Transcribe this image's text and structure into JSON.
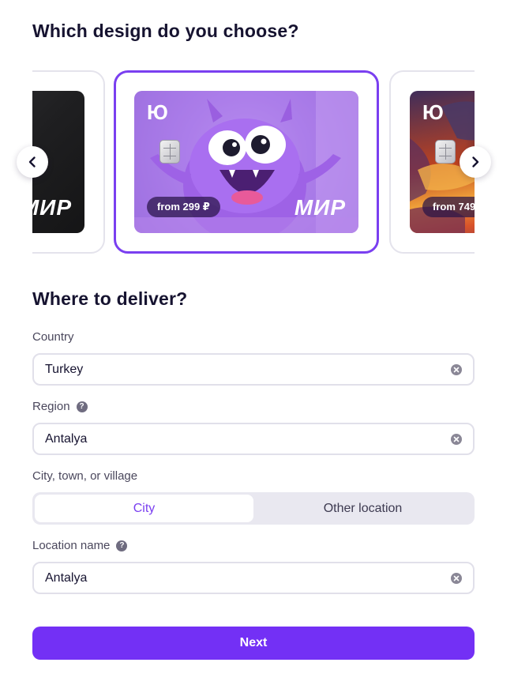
{
  "design_section": {
    "title": "Which design do you choose?",
    "cards": [
      {
        "name": "black",
        "mir": "МИР"
      },
      {
        "name": "monster",
        "logo": "Ю",
        "mir": "МИР",
        "price": "from 299 ₽",
        "selected": true
      },
      {
        "name": "dragon",
        "logo": "Ю",
        "price": "from 749"
      }
    ],
    "prev_icon": "chevron-left-icon",
    "next_icon": "chevron-right-icon"
  },
  "delivery_section": {
    "title": "Where to deliver?",
    "country": {
      "label": "Country",
      "value": "Turkey"
    },
    "region": {
      "label": "Region",
      "value": "Antalya",
      "help": "?"
    },
    "settlement": {
      "label": "City, town, or village",
      "options": [
        "City",
        "Other location"
      ],
      "selected": "City"
    },
    "location_name": {
      "label": "Location name",
      "value": "Antalya",
      "help": "?"
    }
  },
  "next_button": "Next",
  "colors": {
    "accent": "#7330f5",
    "selected_border": "#7a3ff0",
    "text_dark": "#161330"
  }
}
